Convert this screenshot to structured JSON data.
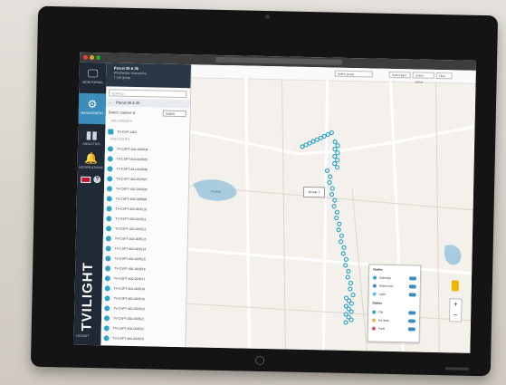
{
  "nav": {
    "items": [
      {
        "icon": "monitor-icon",
        "label": "MONITORING"
      },
      {
        "icon": "gear-icon",
        "label": "MANAGEMENT"
      },
      {
        "icon": "bar-chart-icon",
        "label": "ANALYTICS"
      },
      {
        "icon": "bell-icon",
        "label": "NOTIFICATIONS"
      }
    ],
    "active_index": 1,
    "logo": "TVILIGHT",
    "bottom_label": "LOGOUT"
  },
  "panel": {
    "title": "Parcel 39 & 35",
    "subtitle": "Winchester, Hampshire",
    "subtitle2": "7 sub group",
    "search_placeholder": "SEARCH",
    "back_label": "Parcel 39 & 35",
    "switch_label": "Switch cabinet &",
    "switch_value": "Switch",
    "section_top": "ADD GROUPS",
    "top_device": "TV-CSP-1402",
    "section_devices": "ADD LIGHTS",
    "devices": [
      "TV-CSPT-402-003504",
      "TV-CSPT-402-003505",
      "TV-CSPT-401-003506",
      "TV-CSPT-402-003507",
      "TV-CSPT-402-003508",
      "TV-CSPT-402-003509",
      "TV-CSPT-402-003510",
      "TV-CSPT-402-003511",
      "TV-CSPT-402-003512",
      "TV-CSPT-402-003513",
      "TV-CSPT-402-003514",
      "TV-CSPT-402-003515",
      "TV-CSPT-401-003516",
      "TV-CSPT-402-003517",
      "TV-CSPT-402-003518",
      "TV-CSPT-402-003519",
      "TV-CSPT-402-003520",
      "TV-CSPT-402-003521",
      "TV-CSPT-402-003522",
      "TV-CSPT-402-003523"
    ]
  },
  "map": {
    "dropdowns": [
      "Select group",
      "Select light",
      "Select status",
      "Filter"
    ],
    "callout": "Group 1",
    "lake_label": "Ponds",
    "legend": {
      "title": "Nodes",
      "rows": [
        {
          "label": "Gateway",
          "color": "#2fa4c9"
        },
        {
          "label": "Switch box",
          "color": "#3c8dbc"
        },
        {
          "label": "Light",
          "color": "#5bc0de"
        }
      ],
      "sub_title": "Status",
      "status_rows": [
        {
          "label": "ON",
          "color": "#2fa4c9"
        },
        {
          "label": "No data",
          "color": "#f0ad4e"
        },
        {
          "label": "Fault",
          "color": "#d9534f"
        }
      ]
    },
    "zoom_in": "+",
    "zoom_out": "−"
  },
  "colors": {
    "accent": "#3c8dbc",
    "nav_bg": "#1f2a36",
    "marker": "#2fa4c9"
  }
}
